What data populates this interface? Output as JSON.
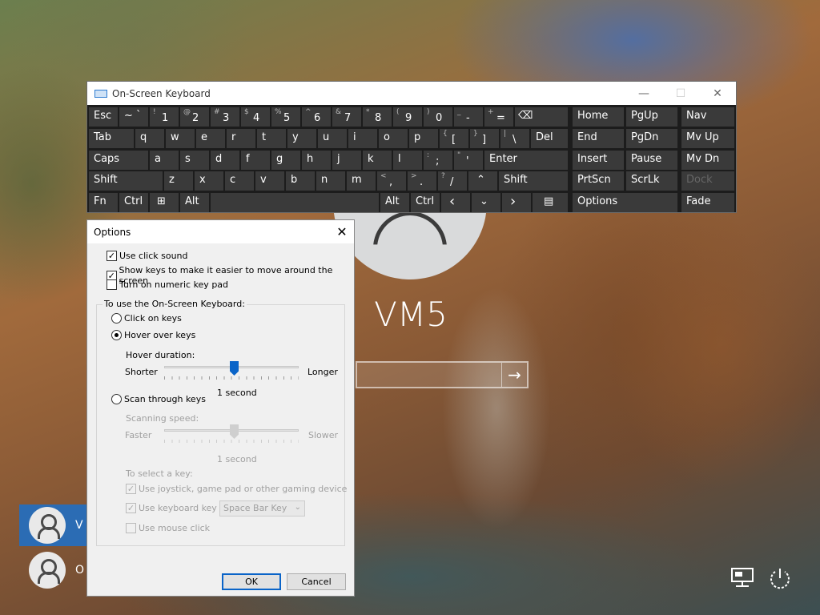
{
  "login": {
    "username": "VM5",
    "users": [
      {
        "initial": "V",
        "selected": true
      },
      {
        "initial": "O",
        "selected": false
      }
    ]
  },
  "osk": {
    "title": "On-Screen Keyboard",
    "window_controls": {
      "minimize": "—",
      "maximize": "☐",
      "close": "✕"
    },
    "row1": {
      "esc": "Esc",
      "tilde": "~ `",
      "k1": {
        "top": "!",
        "main": "1"
      },
      "k2": {
        "top": "@",
        "main": "2"
      },
      "k3": {
        "top": "#",
        "main": "3"
      },
      "k4": {
        "top": "$",
        "main": "4"
      },
      "k5": {
        "top": "%",
        "main": "5"
      },
      "k6": {
        "top": "^",
        "main": "6"
      },
      "k7": {
        "top": "&",
        "main": "7"
      },
      "k8": {
        "top": "*",
        "main": "8"
      },
      "k9": {
        "top": "(",
        "main": "9"
      },
      "k0": {
        "top": ")",
        "main": "0"
      },
      "minus": {
        "top": "_",
        "main": "-"
      },
      "equals": {
        "top": "+",
        "main": "="
      },
      "backspace": "⌫",
      "home": "Home",
      "pgup": "PgUp",
      "nav": "Nav"
    },
    "row2": {
      "tab": "Tab",
      "letters": [
        "q",
        "w",
        "e",
        "r",
        "t",
        "y",
        "u",
        "i",
        "o",
        "p"
      ],
      "lbracket": {
        "top": "{",
        "main": "["
      },
      "rbracket": {
        "top": "}",
        "main": "]"
      },
      "pipe": {
        "top": "|",
        "main": "\\"
      },
      "del": "Del",
      "end": "End",
      "pgdn": "PgDn",
      "mvup": "Mv Up"
    },
    "row3": {
      "caps": "Caps",
      "letters": [
        "a",
        "s",
        "d",
        "f",
        "g",
        "h",
        "j",
        "k",
        "l"
      ],
      "semicolon": {
        "top": ":",
        "main": ";"
      },
      "quote": {
        "top": "\"",
        "main": "'"
      },
      "enter": "Enter",
      "insert": "Insert",
      "pause": "Pause",
      "mvdn": "Mv Dn"
    },
    "row4": {
      "shift_left": "Shift",
      "letters": [
        "z",
        "x",
        "c",
        "v",
        "b",
        "n",
        "m"
      ],
      "comma": {
        "top": "<",
        "main": ","
      },
      "period": {
        "top": ">",
        "main": "."
      },
      "slash": {
        "top": "?",
        "main": "/"
      },
      "up": "⌃",
      "shift_right": "Shift",
      "prtscn": "PrtScn",
      "scrlk": "ScrLk",
      "dock": "Dock"
    },
    "row5": {
      "fn": "Fn",
      "ctrl_left": "Ctrl",
      "win": "⊞",
      "alt_left": "Alt",
      "space": "",
      "alt_right": "Alt",
      "ctrl_right": "Ctrl",
      "left": "‹",
      "down": "⌄",
      "right": "›",
      "menu": "▤",
      "options": "Options",
      "fade": "Fade"
    }
  },
  "options": {
    "title": "Options",
    "close": "✕",
    "use_click_sound": {
      "label": "Use click sound",
      "checked": true
    },
    "show_keys": {
      "label": "Show keys to make it easier to move around the screen",
      "checked": true
    },
    "numeric_pad": {
      "label": "Turn on numeric key pad",
      "checked": false
    },
    "group_label": "To use the On-Screen Keyboard:",
    "click_on_keys": "Click on keys",
    "hover_over_keys": "Hover over keys",
    "hover_duration_label": "Hover duration:",
    "hover_shorter": "Shorter",
    "hover_longer": "Longer",
    "hover_value": "1 second",
    "scan_through_keys": "Scan through keys",
    "scanning_speed_label": "Scanning speed:",
    "scan_faster": "Faster",
    "scan_slower": "Slower",
    "scan_value": "1 second",
    "to_select_label": "To select a key:",
    "use_joystick": "Use joystick, game pad or other gaming device",
    "use_keyboard_key": "Use keyboard key",
    "keyboard_key_value": "Space Bar Key",
    "use_mouse_click": "Use mouse click",
    "ok": "OK",
    "cancel": "Cancel"
  }
}
